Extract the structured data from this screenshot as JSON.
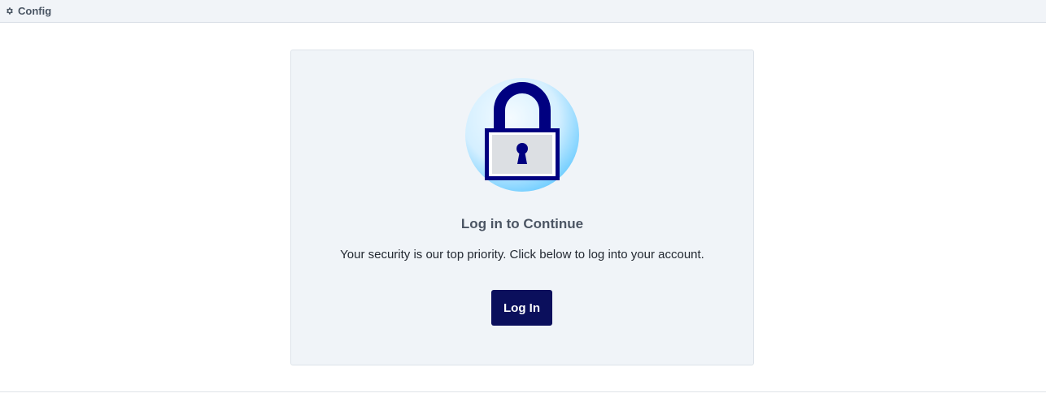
{
  "topbar": {
    "icon": "gear-icon",
    "title": "Config"
  },
  "card": {
    "illustration": "padlock-icon",
    "heading": "Log in to Continue",
    "description": "Your security is our top priority. Click below to log into your account.",
    "login_label": "Log In"
  },
  "colors": {
    "primary": "#0b0f5c",
    "card_bg": "#f0f4f8",
    "topbar_bg": "#f1f4f8",
    "lock_body": "#000080",
    "lock_circle": "#bfe6ff"
  }
}
